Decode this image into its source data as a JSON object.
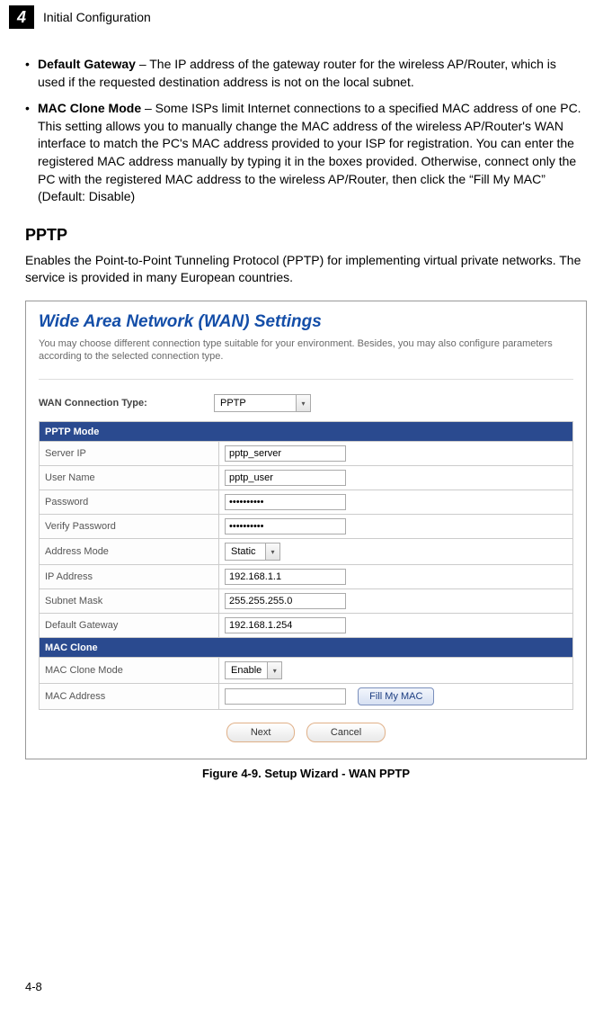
{
  "header": {
    "chapter_number": "4",
    "chapter_title": "Initial Configuration"
  },
  "bullets": [
    {
      "term": "Default Gateway",
      "desc": " – The IP address of the gateway router for the wireless AP/Router, which is used if the requested destination address is not on the local subnet."
    },
    {
      "term": "MAC Clone Mode",
      "desc": " – Some ISPs limit Internet connections to a specified MAC address of one PC. This setting allows you to manually change the MAC address of the wireless AP/Router's WAN interface to match the PC's MAC address provided to your ISP for registration. You can enter the registered MAC address manually by typing it in the boxes provided. Otherwise, connect only the PC with the registered MAC address to the wireless AP/Router, then click the “Fill My MAC” (Default: Disable)"
    }
  ],
  "section": {
    "title": "PPTP",
    "paragraph": "Enables the Point-to-Point Tunneling Protocol (PPTP) for implementing virtual private networks. The service is provided in many European countries."
  },
  "figure": {
    "title": "Wide Area Network (WAN) Settings",
    "desc": "You may choose different connection type suitable for your environment. Besides, you may also configure parameters according to the selected connection type.",
    "wan_type_label": "WAN Connection Type:",
    "wan_type_value": "PPTP",
    "sections": {
      "pptp": "PPTP Mode",
      "mac": "MAC Clone"
    },
    "fields": {
      "server_ip": {
        "label": "Server IP",
        "value": "pptp_server"
      },
      "user_name": {
        "label": "User Name",
        "value": "pptp_user"
      },
      "password": {
        "label": "Password",
        "value": "••••••••••"
      },
      "verify_password": {
        "label": "Verify Password",
        "value": "••••••••••"
      },
      "address_mode": {
        "label": "Address Mode",
        "value": "Static"
      },
      "ip_address": {
        "label": "IP Address",
        "value": "192.168.1.1"
      },
      "subnet_mask": {
        "label": "Subnet Mask",
        "value": "255.255.255.0"
      },
      "default_gw": {
        "label": "Default Gateway",
        "value": "192.168.1.254"
      },
      "mac_clone_mode": {
        "label": "MAC Clone Mode",
        "value": "Enable"
      },
      "mac_address": {
        "label": "MAC Address",
        "value": ""
      }
    },
    "buttons": {
      "fill_mac": "Fill My MAC",
      "next": "Next",
      "cancel": "Cancel"
    },
    "caption": "Figure 4-9.   Setup Wizard - WAN PPTP"
  },
  "footer": {
    "page": "4-8"
  }
}
